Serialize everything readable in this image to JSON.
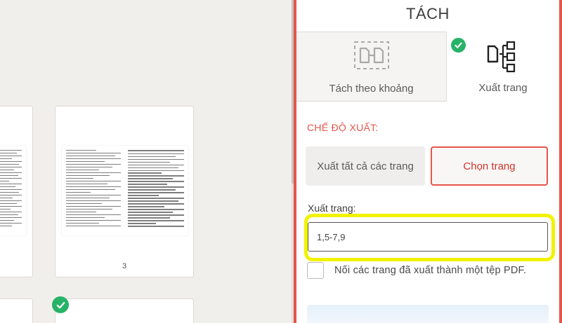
{
  "pages": {
    "main_thumb_number": "3"
  },
  "panel": {
    "title": "TÁCH",
    "tabs": [
      {
        "label": "Tách theo khoảng",
        "icon": "split-range-icon",
        "selected": false
      },
      {
        "label": "Xuất trang",
        "icon": "extract-pages-icon",
        "selected": true
      }
    ],
    "mode_section_label": "CHẾ ĐỘ XUẤT:",
    "mode_options": [
      {
        "label": "Xuất tất cả các trang",
        "selected": false
      },
      {
        "label": "Chọn trang",
        "selected": true
      }
    ],
    "pages_field": {
      "label": "Xuất trang:",
      "value": "1,5-7,9"
    },
    "merge_checkbox": {
      "label": "Nối các trang đã xuất thành một tệp PDF.",
      "checked": false
    }
  },
  "colors": {
    "accent": "#e5564a",
    "success": "#26b367",
    "highlight": "#f2f200"
  }
}
